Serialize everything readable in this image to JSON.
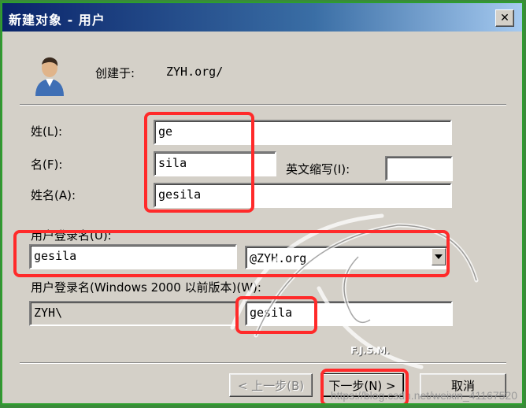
{
  "window": {
    "title": "新建对象 - 用户",
    "close_glyph": "✕"
  },
  "created_in": {
    "label": "创建于:",
    "value": "ZYH.org/"
  },
  "form": {
    "last_name": {
      "label": "姓(L):",
      "value": "ge"
    },
    "first_name": {
      "label": "名(F):",
      "value": "sila"
    },
    "initials": {
      "label": "英文缩写(I):",
      "value": ""
    },
    "full_name": {
      "label": "姓名(A):",
      "value": "gesila"
    },
    "logon_name": {
      "label": "用户登录名(U):",
      "value": "gesila",
      "domain": "@ZYH.org"
    },
    "pre2000_logon": {
      "label": "用户登录名(Windows 2000 以前版本)(W):",
      "domain": "ZYH\\",
      "value": "gesila"
    }
  },
  "buttons": {
    "back": "< 上一步(B)",
    "next": "下一步(N) >",
    "cancel": "取消"
  },
  "watermark": {
    "logo_text": "F.J.S.M.",
    "url": "https://blog.csdn.net/weixin_41167520"
  },
  "colors": {
    "annotation": "#ff2a2a",
    "title_bar": "#0a246a",
    "dialog_bg": "#d4d0c8"
  }
}
